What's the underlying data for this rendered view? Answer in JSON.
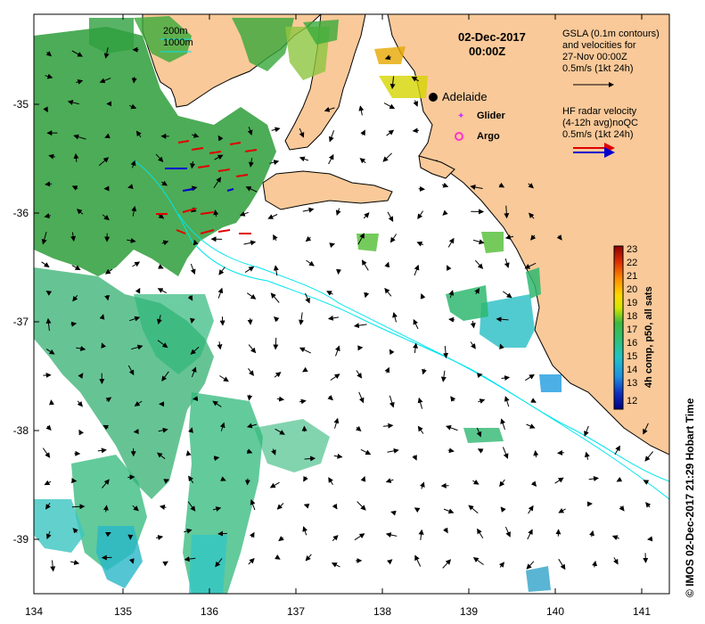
{
  "colors": {
    "land": "#f9c999",
    "coast": "#000000",
    "isobath": "#00e5ee",
    "background": "#ffffff",
    "radar_red": "#e00000",
    "radar_blue": "#0000d0",
    "glider": "#cc33ff",
    "argo": "#ff33cc"
  },
  "map": {
    "title_date": "02-Dec-2017",
    "title_time": "00:00Z",
    "city": "Adelaide",
    "legend_glider": "Glider",
    "legend_argo": "Argo",
    "isobath_200": "200m",
    "isobath_1000": "1000m",
    "gsla_1": "GSLA (0.1m contours)",
    "gsla_2": "and velocities for",
    "gsla_3": "27-Nov 00:00Z",
    "gsla_4": "0.5m/s (1kt 24h)",
    "hf_1": "HF radar velocity",
    "hf_2": "(4-12h avg)noQC",
    "hf_3": "0.5m/s (1kt 24h)",
    "colorbar_label": "4h comp, p50, all sats",
    "colorbar_ticks": [
      "23",
      "22",
      "21",
      "20",
      "19",
      "18",
      "17",
      "16",
      "15",
      "14",
      "13",
      "12"
    ],
    "credit": "© IMOS 02-Dec-2017 21:29 Hobart Time"
  },
  "axes": {
    "lat_ticks": [
      "-35",
      "-36",
      "-37",
      "-38",
      "-39"
    ],
    "lon_ticks": [
      "134",
      "135",
      "136",
      "137",
      "138",
      "139",
      "140",
      "141"
    ]
  }
}
